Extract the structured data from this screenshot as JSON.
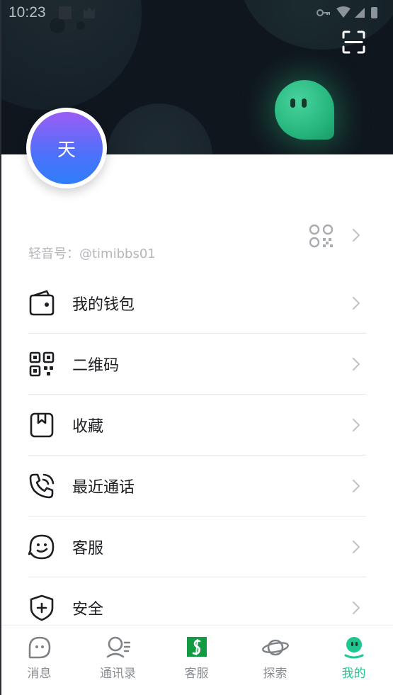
{
  "status_bar": {
    "time": "10:23"
  },
  "header": {
    "scan_icon": "scan-icon",
    "mascot": "ghost-mascot"
  },
  "profile": {
    "avatar_text": "天",
    "account_id": "轻音号：@timibbs01",
    "qr_icon": "qr-code-icon"
  },
  "menu": {
    "items": [
      {
        "label": "我的钱包",
        "icon": "wallet-icon"
      },
      {
        "label": "二维码",
        "icon": "qr-code-icon"
      },
      {
        "label": "收藏",
        "icon": "bookmark-icon"
      },
      {
        "label": "最近通话",
        "icon": "phone-call-icon"
      },
      {
        "label": "客服",
        "icon": "customer-service-icon"
      },
      {
        "label": "安全",
        "icon": "shield-icon"
      }
    ]
  },
  "tabbar": {
    "tabs": [
      {
        "label": "消息",
        "icon": "chat-bubble-icon",
        "active": false
      },
      {
        "label": "通讯录",
        "icon": "contacts-icon",
        "active": false
      },
      {
        "label": "客服",
        "icon": "service-app-icon",
        "active": false
      },
      {
        "label": "探索",
        "icon": "planet-icon",
        "active": false
      },
      {
        "label": "我的",
        "icon": "me-icon",
        "active": true
      }
    ]
  },
  "colors": {
    "accent": "#1ec790",
    "header_bg": "#10161e",
    "avatar_gradient_top": "#9b5cf5",
    "avatar_gradient_bottom": "#2f7dfa"
  }
}
